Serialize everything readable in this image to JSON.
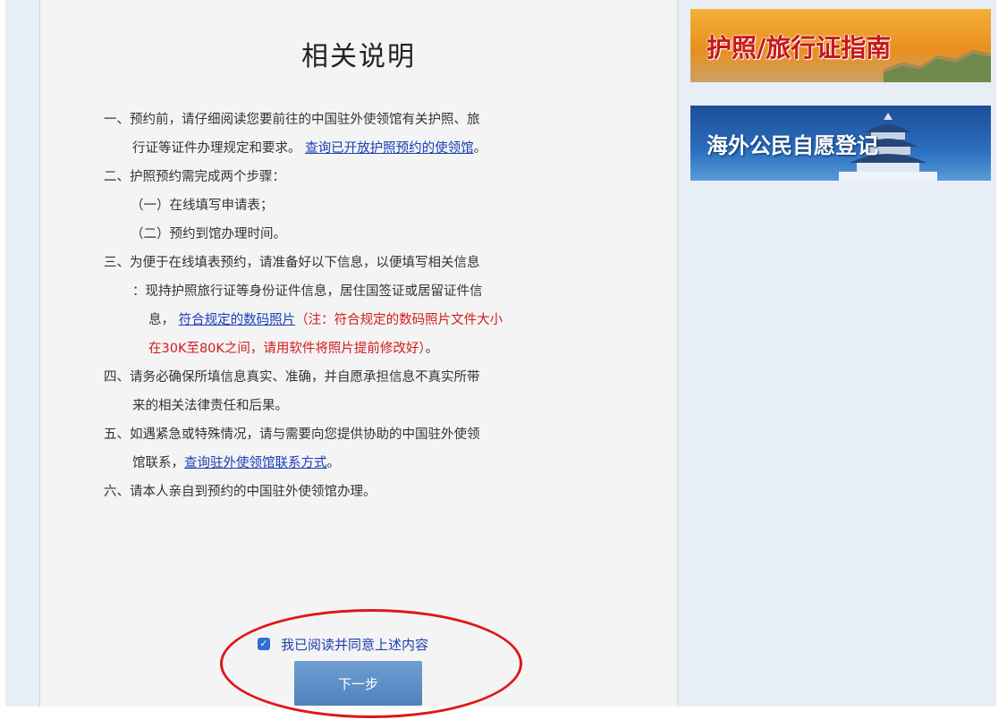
{
  "page": {
    "title": "相关说明"
  },
  "instructions": {
    "item1_a": "一、预约前，请仔细阅读您要前往的中国驻外使领馆有关护照、旅",
    "item1_b": "行证等证件办理规定和要求。",
    "item1_link": "查询已开放护照预约的使领馆",
    "item1_end": "。",
    "item2": "二、护照预约需完成两个步骤：",
    "item2_sub1": "（一）在线填写申请表；",
    "item2_sub2": "（二）预约到馆办理时间。",
    "item3_a": "三、为便于在线填表预约，请准备好以下信息，以便填写相关信息",
    "item3_b": "：现持护照旅行证等身份证件信息，居住国签证或居留证件信",
    "item3_c": "息，",
    "item3_link": "符合规定的数码照片",
    "item3_note1": "（注：符合规定的数码照片文件大小",
    "item3_note2": "在30K至80K之间，请用软件将照片提前修改好）",
    "item3_end": "。",
    "item4_a": "四、请务必确保所填信息真实、准确，并自愿承担信息不真实所带",
    "item4_b": "来的相关法律责任和后果。",
    "item5_a": "五、如遇紧急或特殊情况，请与需要向您提供协助的中国驻外使领",
    "item5_b": "馆联系，",
    "item5_link": "查询驻外使领馆联系方式",
    "item5_end": "。",
    "item6": "六、请本人亲自到预约的中国驻外使领馆办理。"
  },
  "agreement": {
    "checkbox_label": "我已阅读并同意上述内容",
    "checked": true,
    "next_button": "下一步"
  },
  "sidebar": {
    "banner1_text": "护照/旅行证指南",
    "banner2_text": "海外公民自愿登记"
  },
  "colors": {
    "link": "#1a3db8",
    "note_red": "#d41a1a",
    "button": "#5a8cc8",
    "annotation_ellipse": "#e01717"
  }
}
